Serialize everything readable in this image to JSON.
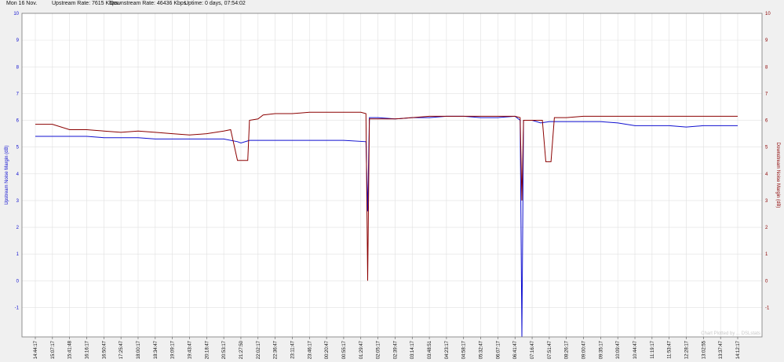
{
  "header": {
    "date": "Mon 16 Nov.",
    "upstream_rate": "Upstream Rate: 7615 Kbps.",
    "downstream_rate": "Downstream Rate: 46436 Kbps.",
    "uptime": "Uptime: 0 days, 07:54:02"
  },
  "colors": {
    "upstream": "#1010d0",
    "downstream": "#8b0000",
    "grid": "#e0e0e0",
    "axis": "#000000"
  },
  "chart_data": {
    "type": "line",
    "title": "",
    "left_ylabel": "Upstream Noise Margin (dB)",
    "right_ylabel": "Downstream Noise Margin (dB)",
    "ylim": [
      -2.1,
      10
    ],
    "yticks": [
      -1,
      0,
      1,
      2,
      3,
      4,
      5,
      6,
      7,
      8,
      9,
      10
    ],
    "grid": true,
    "watermark": "Chart Plotted by ... DSLstats",
    "xticks": [
      "14:44:17",
      "15:07:17",
      "15:41:48",
      "16:16:17",
      "16:50:47",
      "17:25:47",
      "18:00:17",
      "18:34:47",
      "19:09:17",
      "19:43:47",
      "20:18:47",
      "20:53:17",
      "21:27:50",
      "22:02:17",
      "22:36:47",
      "23:11:47",
      "23:46:17",
      "00:20:47",
      "00:55:17",
      "01:29:47",
      "02:05:17",
      "02:39:47",
      "03:14:17",
      "03:48:51",
      "04:23:17",
      "04:58:17",
      "05:32:47",
      "06:07:17",
      "06:41:47",
      "07:16:47",
      "07:51:47",
      "08:26:17",
      "09:00:47",
      "09:35:17",
      "10:09:47",
      "10:44:47",
      "11:19:17",
      "11:53:47",
      "12:28:17",
      "13:02:55",
      "13:37:47",
      "14:12:17"
    ],
    "x_range": [
      0,
      41
    ],
    "series": [
      {
        "name": "Upstream Noise Margin",
        "axis": "left",
        "points": [
          [
            0,
            5.4
          ],
          [
            1,
            5.4
          ],
          [
            2,
            5.4
          ],
          [
            3,
            5.4
          ],
          [
            4,
            5.35
          ],
          [
            5,
            5.35
          ],
          [
            6,
            5.35
          ],
          [
            7,
            5.3
          ],
          [
            8,
            5.3
          ],
          [
            9,
            5.3
          ],
          [
            10,
            5.3
          ],
          [
            11,
            5.3
          ],
          [
            11.8,
            5.2
          ],
          [
            12,
            5.15
          ],
          [
            12.5,
            5.25
          ],
          [
            13,
            5.25
          ],
          [
            14,
            5.25
          ],
          [
            15,
            5.25
          ],
          [
            16,
            5.25
          ],
          [
            17,
            5.25
          ],
          [
            18,
            5.25
          ],
          [
            19.3,
            5.2
          ],
          [
            19.4,
            2.6
          ],
          [
            19.5,
            6.1
          ],
          [
            20,
            6.1
          ],
          [
            21,
            6.05
          ],
          [
            22,
            6.1
          ],
          [
            23,
            6.1
          ],
          [
            24,
            6.15
          ],
          [
            25,
            6.15
          ],
          [
            26,
            6.1
          ],
          [
            27,
            6.1
          ],
          [
            28,
            6.15
          ],
          [
            28.3,
            6.0
          ],
          [
            28.4,
            -2.1
          ],
          [
            28.5,
            6.0
          ],
          [
            29,
            6.0
          ],
          [
            29.5,
            5.9
          ],
          [
            30,
            5.95
          ],
          [
            31,
            5.95
          ],
          [
            32,
            5.95
          ],
          [
            33,
            5.95
          ],
          [
            34,
            5.9
          ],
          [
            35,
            5.8
          ],
          [
            36,
            5.8
          ],
          [
            37,
            5.8
          ],
          [
            38,
            5.75
          ],
          [
            39,
            5.8
          ],
          [
            40,
            5.8
          ],
          [
            41,
            5.8
          ]
        ]
      },
      {
        "name": "Downstream Noise Margin",
        "axis": "right",
        "points": [
          [
            0,
            5.85
          ],
          [
            1,
            5.85
          ],
          [
            2,
            5.65
          ],
          [
            3,
            5.65
          ],
          [
            4,
            5.6
          ],
          [
            5,
            5.55
          ],
          [
            6,
            5.6
          ],
          [
            7,
            5.55
          ],
          [
            8,
            5.5
          ],
          [
            9,
            5.45
          ],
          [
            10,
            5.5
          ],
          [
            11,
            5.6
          ],
          [
            11.4,
            5.65
          ],
          [
            11.8,
            4.5
          ],
          [
            12.4,
            4.5
          ],
          [
            12.5,
            6.0
          ],
          [
            13,
            6.05
          ],
          [
            13.3,
            6.2
          ],
          [
            14,
            6.25
          ],
          [
            15,
            6.25
          ],
          [
            16,
            6.3
          ],
          [
            17,
            6.3
          ],
          [
            18,
            6.3
          ],
          [
            19,
            6.3
          ],
          [
            19.3,
            6.25
          ],
          [
            19.4,
            0
          ],
          [
            19.5,
            6.05
          ],
          [
            20,
            6.05
          ],
          [
            21,
            6.05
          ],
          [
            22,
            6.1
          ],
          [
            23,
            6.15
          ],
          [
            24,
            6.15
          ],
          [
            25,
            6.15
          ],
          [
            26,
            6.15
          ],
          [
            27,
            6.15
          ],
          [
            28,
            6.15
          ],
          [
            28.3,
            6.1
          ],
          [
            28.4,
            3.0
          ],
          [
            28.5,
            6.0
          ],
          [
            29,
            6.0
          ],
          [
            29.6,
            6.0
          ],
          [
            29.8,
            4.45
          ],
          [
            30.1,
            4.45
          ],
          [
            30.3,
            6.1
          ],
          [
            31,
            6.1
          ],
          [
            32,
            6.15
          ],
          [
            33,
            6.15
          ],
          [
            34,
            6.15
          ],
          [
            35,
            6.15
          ],
          [
            36,
            6.15
          ],
          [
            37,
            6.15
          ],
          [
            38,
            6.15
          ],
          [
            39,
            6.15
          ],
          [
            40,
            6.15
          ],
          [
            41,
            6.15
          ]
        ]
      }
    ]
  }
}
